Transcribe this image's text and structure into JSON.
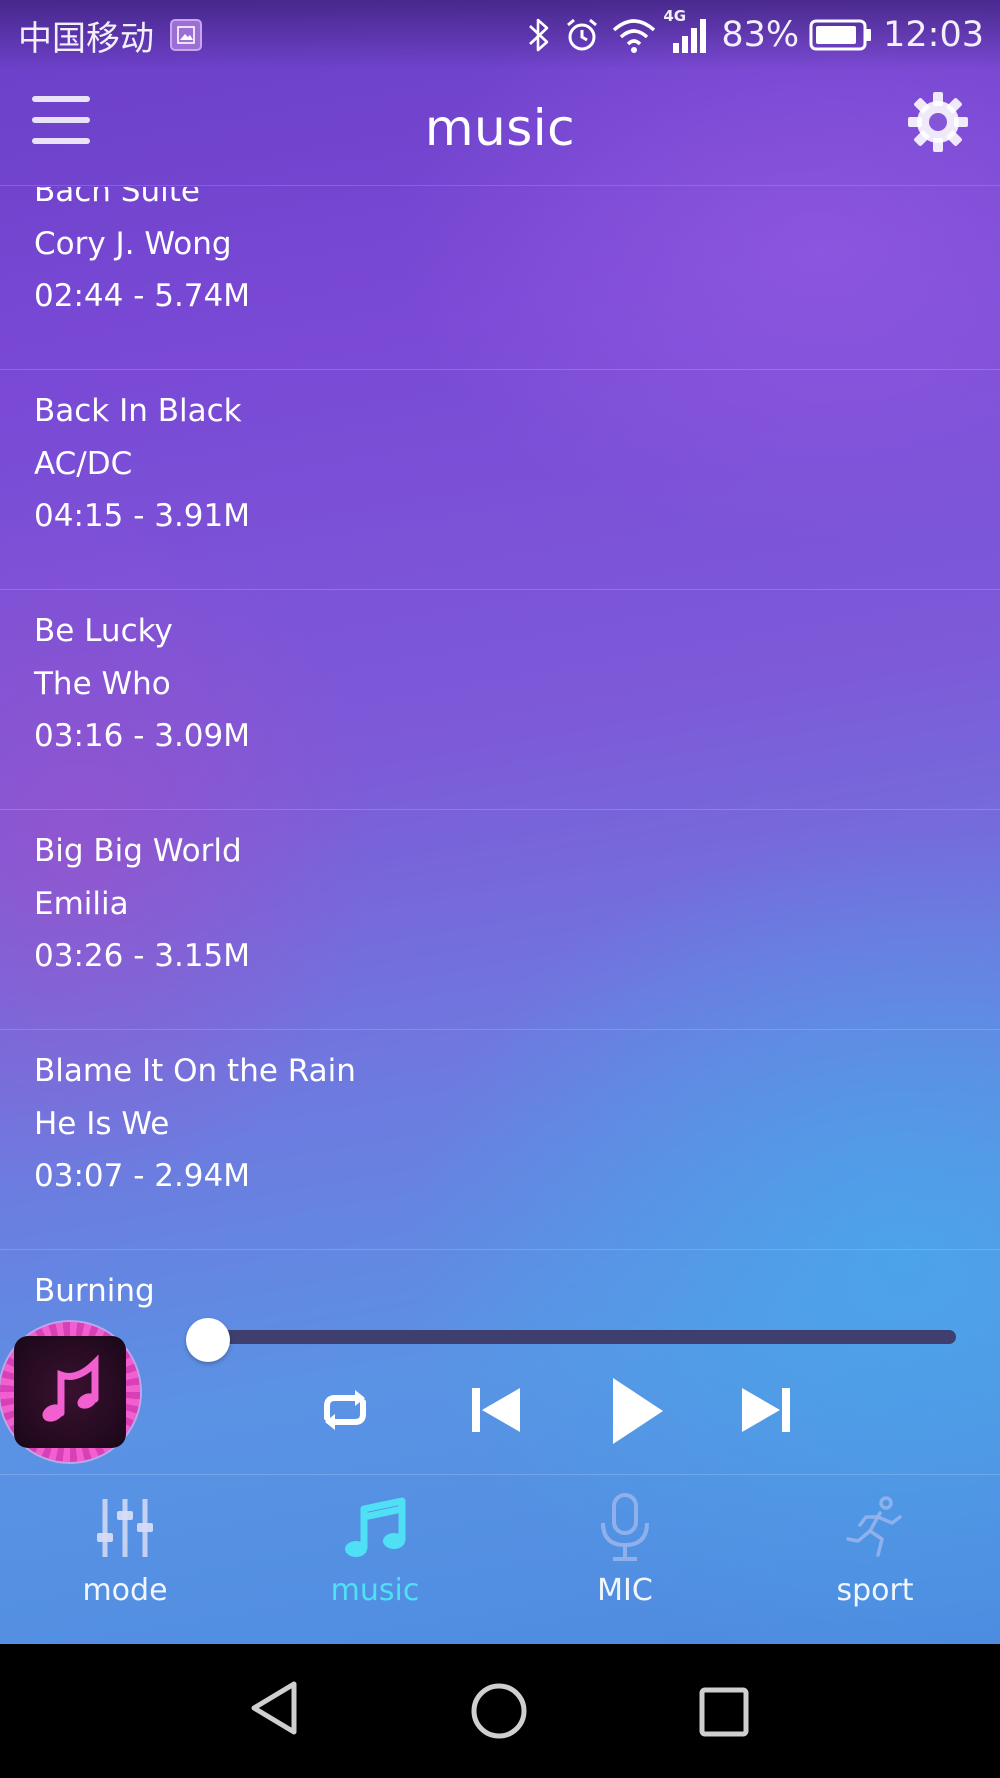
{
  "status_bar": {
    "carrier": "中国移动",
    "network": "4G",
    "battery": "83%",
    "time": "12:03",
    "icons": [
      "gallery-icon",
      "bluetooth-icon",
      "alarm-icon",
      "wifi-icon",
      "signal-icon",
      "battery-icon"
    ]
  },
  "header": {
    "title": "music",
    "menu_icon": "hamburger-menu-icon",
    "settings_icon": "gear-icon"
  },
  "songs": [
    {
      "title": "Bach Suite",
      "artist": "Cory J. Wong",
      "meta": "02:44 - 5.74M"
    },
    {
      "title": "Back In Black",
      "artist": "AC/DC",
      "meta": "04:15 - 3.91M"
    },
    {
      "title": "Be Lucky",
      "artist": "The Who",
      "meta": "03:16 - 3.09M"
    },
    {
      "title": "Big Big World",
      "artist": "Emilia",
      "meta": "03:26 - 3.15M"
    },
    {
      "title": "Blame It On the Rain",
      "artist": "He Is We",
      "meta": "03:07 - 2.94M"
    },
    {
      "title": "Burning",
      "artist": "",
      "meta": ""
    }
  ],
  "player": {
    "progress": 0,
    "album_icon": "music-note-icon",
    "controls": [
      "repeat-icon",
      "previous-icon",
      "play-icon",
      "next-icon"
    ]
  },
  "tabs": [
    {
      "label": "mode",
      "icon": "equalizer-sliders-icon",
      "active": false
    },
    {
      "label": "music",
      "icon": "music-note-icon",
      "active": true
    },
    {
      "label": "MIC",
      "icon": "microphone-icon",
      "active": false
    },
    {
      "label": "sport",
      "icon": "running-person-icon",
      "active": false
    }
  ],
  "colors": {
    "accent": "#4fe0f5",
    "progress_track": "#3e3f6e",
    "album_pink": "#f25fcf"
  },
  "system_nav": [
    "back-icon",
    "home-icon",
    "recents-icon"
  ]
}
